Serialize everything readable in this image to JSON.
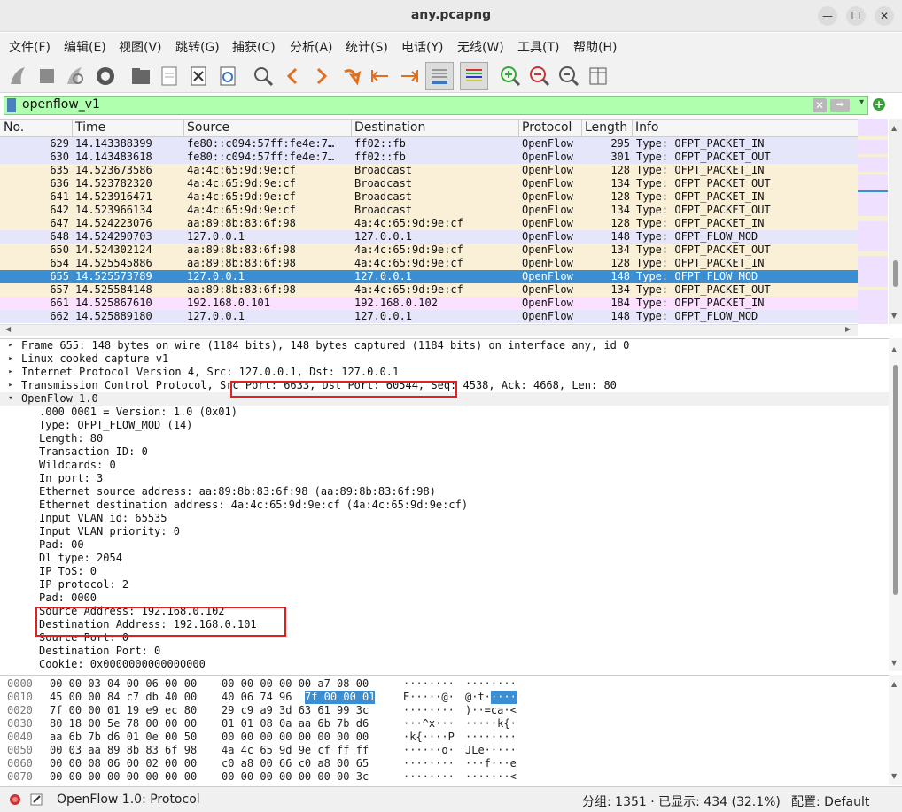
{
  "window": {
    "title": "any.pcapng"
  },
  "menu": [
    "文件(F)",
    "编辑(E)",
    "视图(V)",
    "跳转(G)",
    "捕获(C)",
    "分析(A)",
    "统计(S)",
    "电话(Y)",
    "无线(W)",
    "工具(T)",
    "帮助(H)"
  ],
  "filter": {
    "value": "openflow_v1"
  },
  "packet_list": {
    "headers": [
      "No.",
      "Time",
      "Source",
      "Destination",
      "Protocol",
      "Length",
      "Info"
    ],
    "rows": [
      {
        "no": "629",
        "time": "14.143388399",
        "src": "fe80::c094:57ff:fe4e:7…",
        "dst": "ff02::fb",
        "proto": "OpenFlow",
        "len": "295",
        "info": "Type: OFPT_PACKET_IN",
        "bg": "#e6e6fa"
      },
      {
        "no": "630",
        "time": "14.143483618",
        "src": "fe80::c094:57ff:fe4e:7…",
        "dst": "ff02::fb",
        "proto": "OpenFlow",
        "len": "301",
        "info": "Type: OFPT_PACKET_OUT",
        "bg": "#e6e6fa"
      },
      {
        "no": "635",
        "time": "14.523673586",
        "src": "4a:4c:65:9d:9e:cf",
        "dst": "Broadcast",
        "proto": "OpenFlow",
        "len": "128",
        "info": "Type: OFPT_PACKET_IN",
        "bg": "#faf0d7"
      },
      {
        "no": "636",
        "time": "14.523782320",
        "src": "4a:4c:65:9d:9e:cf",
        "dst": "Broadcast",
        "proto": "OpenFlow",
        "len": "134",
        "info": "Type: OFPT_PACKET_OUT",
        "bg": "#faf0d7"
      },
      {
        "no": "641",
        "time": "14.523916471",
        "src": "4a:4c:65:9d:9e:cf",
        "dst": "Broadcast",
        "proto": "OpenFlow",
        "len": "128",
        "info": "Type: OFPT_PACKET_IN",
        "bg": "#faf0d7"
      },
      {
        "no": "642",
        "time": "14.523966134",
        "src": "4a:4c:65:9d:9e:cf",
        "dst": "Broadcast",
        "proto": "OpenFlow",
        "len": "134",
        "info": "Type: OFPT_PACKET_OUT",
        "bg": "#faf0d7"
      },
      {
        "no": "647",
        "time": "14.524223076",
        "src": "aa:89:8b:83:6f:98",
        "dst": "4a:4c:65:9d:9e:cf",
        "proto": "OpenFlow",
        "len": "128",
        "info": "Type: OFPT_PACKET_IN",
        "bg": "#faf0d7"
      },
      {
        "no": "648",
        "time": "14.524290703",
        "src": "127.0.0.1",
        "dst": "127.0.0.1",
        "proto": "OpenFlow",
        "len": "148",
        "info": "Type: OFPT_FLOW_MOD",
        "bg": "#e6e6fa"
      },
      {
        "no": "650",
        "time": "14.524302124",
        "src": "aa:89:8b:83:6f:98",
        "dst": "4a:4c:65:9d:9e:cf",
        "proto": "OpenFlow",
        "len": "134",
        "info": "Type: OFPT_PACKET_OUT",
        "bg": "#faf0d7"
      },
      {
        "no": "654",
        "time": "14.525545886",
        "src": "aa:89:8b:83:6f:98",
        "dst": "4a:4c:65:9d:9e:cf",
        "proto": "OpenFlow",
        "len": "128",
        "info": "Type: OFPT_PACKET_IN",
        "bg": "#faf0d7"
      },
      {
        "no": "655",
        "time": "14.525573789",
        "src": "127.0.0.1",
        "dst": "127.0.0.1",
        "proto": "OpenFlow",
        "len": "148",
        "info": "Type: OFPT_FLOW_MOD",
        "bg": "#3b8ed1",
        "selected": true
      },
      {
        "no": "657",
        "time": "14.525584148",
        "src": "aa:89:8b:83:6f:98",
        "dst": "4a:4c:65:9d:9e:cf",
        "proto": "OpenFlow",
        "len": "134",
        "info": "Type: OFPT_PACKET_OUT",
        "bg": "#faf0d7"
      },
      {
        "no": "661",
        "time": "14.525867610",
        "src": "192.168.0.101",
        "dst": "192.168.0.102",
        "proto": "OpenFlow",
        "len": "184",
        "info": "Type: OFPT_PACKET_IN",
        "bg": "#fce0ff"
      },
      {
        "no": "662",
        "time": "14.525889180",
        "src": "127.0.0.1",
        "dst": "127.0.0.1",
        "proto": "OpenFlow",
        "len": "148",
        "info": "Type: OFPT_FLOW_MOD",
        "bg": "#e6e6fa"
      }
    ]
  },
  "details": [
    {
      "indent": 0,
      "arrow": "▸",
      "text": "Frame 655: 148 bytes on wire (1184 bits), 148 bytes captured (1184 bits) on interface any, id 0"
    },
    {
      "indent": 0,
      "arrow": "▸",
      "text": "Linux cooked capture v1"
    },
    {
      "indent": 0,
      "arrow": "▸",
      "text": "Internet Protocol Version 4, Src: 127.0.0.1, Dst: 127.0.0.1"
    },
    {
      "indent": 0,
      "arrow": "▸",
      "text": "Transmission Control Protocol, Src Port: 6633, Dst Port: 60544, Seq: 4538, Ack: 4668, Len: 80"
    },
    {
      "indent": 0,
      "arrow": "▾",
      "text": "OpenFlow 1.0",
      "hl": true
    },
    {
      "indent": 1,
      "text": ".000 0001 = Version: 1.0 (0x01)"
    },
    {
      "indent": 1,
      "text": "Type: OFPT_FLOW_MOD (14)"
    },
    {
      "indent": 1,
      "text": "Length: 80"
    },
    {
      "indent": 1,
      "text": "Transaction ID: 0"
    },
    {
      "indent": 1,
      "text": "Wildcards: 0"
    },
    {
      "indent": 1,
      "text": "In port: 3"
    },
    {
      "indent": 1,
      "text": "Ethernet source address: aa:89:8b:83:6f:98 (aa:89:8b:83:6f:98)"
    },
    {
      "indent": 1,
      "text": "Ethernet destination address: 4a:4c:65:9d:9e:cf (4a:4c:65:9d:9e:cf)"
    },
    {
      "indent": 1,
      "text": "Input VLAN id: 65535"
    },
    {
      "indent": 1,
      "text": "Input VLAN priority: 0"
    },
    {
      "indent": 1,
      "text": "Pad: 00"
    },
    {
      "indent": 1,
      "text": "Dl type: 2054"
    },
    {
      "indent": 1,
      "text": "IP ToS: 0"
    },
    {
      "indent": 1,
      "text": "IP protocol: 2"
    },
    {
      "indent": 1,
      "text": "Pad: 0000"
    },
    {
      "indent": 1,
      "text": "Source Address: 192.168.0.102"
    },
    {
      "indent": 1,
      "text": "Destination Address: 192.168.0.101"
    },
    {
      "indent": 1,
      "text": "Source Port: 0"
    },
    {
      "indent": 1,
      "text": "Destination Port: 0"
    },
    {
      "indent": 1,
      "text": "Cookie: 0x0000000000000000"
    }
  ],
  "hex": [
    {
      "off": "0000",
      "b1": "00 00 03 04 00 06 00 00",
      "b2": "00 00 00 00 00 a7 08 00",
      "a1": "········",
      "a2": "········"
    },
    {
      "off": "0010",
      "b1": "45 00 00 84 c7 db 40 00",
      "b2": "40 06 74 96",
      "b2sel": "7f 00 00 01",
      "a1": "E·····@·",
      "a2": "@·t·",
      "a2sel": "····"
    },
    {
      "off": "0020",
      "b1": "7f 00 00 01 19 e9 ec 80",
      "b2": "29 c9 a9 3d 63 61 99 3c",
      "a1": "········",
      "a2": ")··=ca·<"
    },
    {
      "off": "0030",
      "b1": "80 18 00 5e 78 00 00 00",
      "b2": "01 01 08 0a aa 6b 7b d6",
      "a1": "···^x···",
      "a2": "·····k{·"
    },
    {
      "off": "0040",
      "b1": "aa 6b 7b d6 01 0e 00 50",
      "b2": "00 00 00 00 00 00 00 00",
      "a1": "·k{····P",
      "a2": "········"
    },
    {
      "off": "0050",
      "b1": "00 03 aa 89 8b 83 6f 98",
      "b2": "4a 4c 65 9d 9e cf ff ff",
      "a1": "······o·",
      "a2": "JLe·····"
    },
    {
      "off": "0060",
      "b1": "00 00 08 06 00 02 00 00",
      "b2": "c0 a8 00 66 c0 a8 00 65",
      "a1": "········",
      "a2": "···f···e"
    },
    {
      "off": "0070",
      "b1": "00 00 00 00 00 00 00 00",
      "b2": "00 00 00 00 00 00 00 3c",
      "a1": "········",
      "a2": "·······<"
    }
  ],
  "status": {
    "text": "OpenFlow 1.0: Protocol",
    "packets": "分组: 1351 · 已显示: 434 (32.1%)",
    "profile": "配置: Default"
  }
}
